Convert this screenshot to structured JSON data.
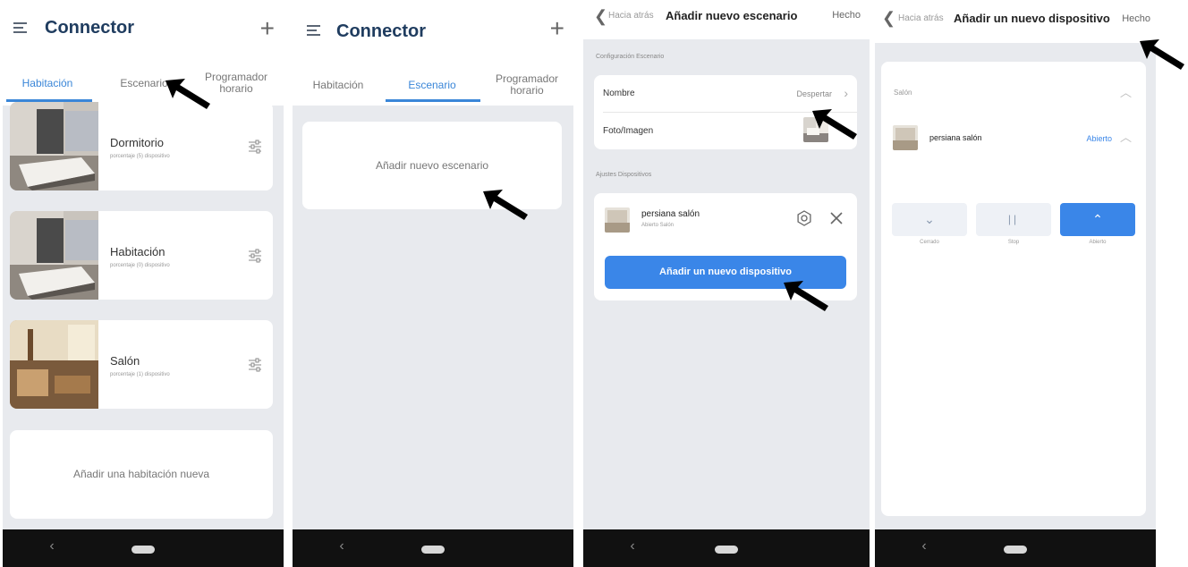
{
  "common": {
    "back_glyph": "‹"
  },
  "screen1": {
    "title": "Connector",
    "tabs": [
      "Habitación",
      "Escenario",
      "Programador horario"
    ],
    "active_tab": 0,
    "rooms": [
      {
        "name": "Dormitorio",
        "subtitle": "porcentaje (5) dispositivo"
      },
      {
        "name": "Habitación",
        "subtitle": "porcentaje (0) dispositivo"
      },
      {
        "name": "Salón",
        "subtitle": "porcentaje (1) dispositivo"
      }
    ],
    "add_room": "Añadir una habitación nueva"
  },
  "screen2": {
    "title": "Connector",
    "tabs": [
      "Habitación",
      "Escenario",
      "Programador horario"
    ],
    "active_tab": 1,
    "add_scenario": "Añadir nuevo escenario"
  },
  "screen3": {
    "back": "Hacia atrás",
    "title": "Añadir nuevo escenario",
    "done": "Hecho",
    "section_config": "Configuración Escenario",
    "name_label": "Nombre",
    "name_value": "Despertar",
    "photo_label": "Foto/Imagen",
    "section_devices": "Ajustes Dispositivos",
    "device_name": "persiana salón",
    "device_sub": "Abierto Salón",
    "add_device": "Añadir un nuevo dispositivo"
  },
  "screen4": {
    "back": "Hacia atrás",
    "title": "Añadir un nuevo dispositivo",
    "done": "Hecho",
    "room": "Salón",
    "device_name": "persiana salón",
    "device_state": "Abierto",
    "controls": [
      {
        "label": "Cerrado",
        "icon": "chevron-down-icon"
      },
      {
        "label": "Stop",
        "icon": "pause-icon"
      },
      {
        "label": "Abierto",
        "icon": "chevron-up-icon"
      }
    ],
    "active_control": 2
  },
  "colors": {
    "accent": "#3a86e8",
    "title": "#1f3c5f",
    "background": "#e8eaee",
    "navbar": "#111111"
  }
}
